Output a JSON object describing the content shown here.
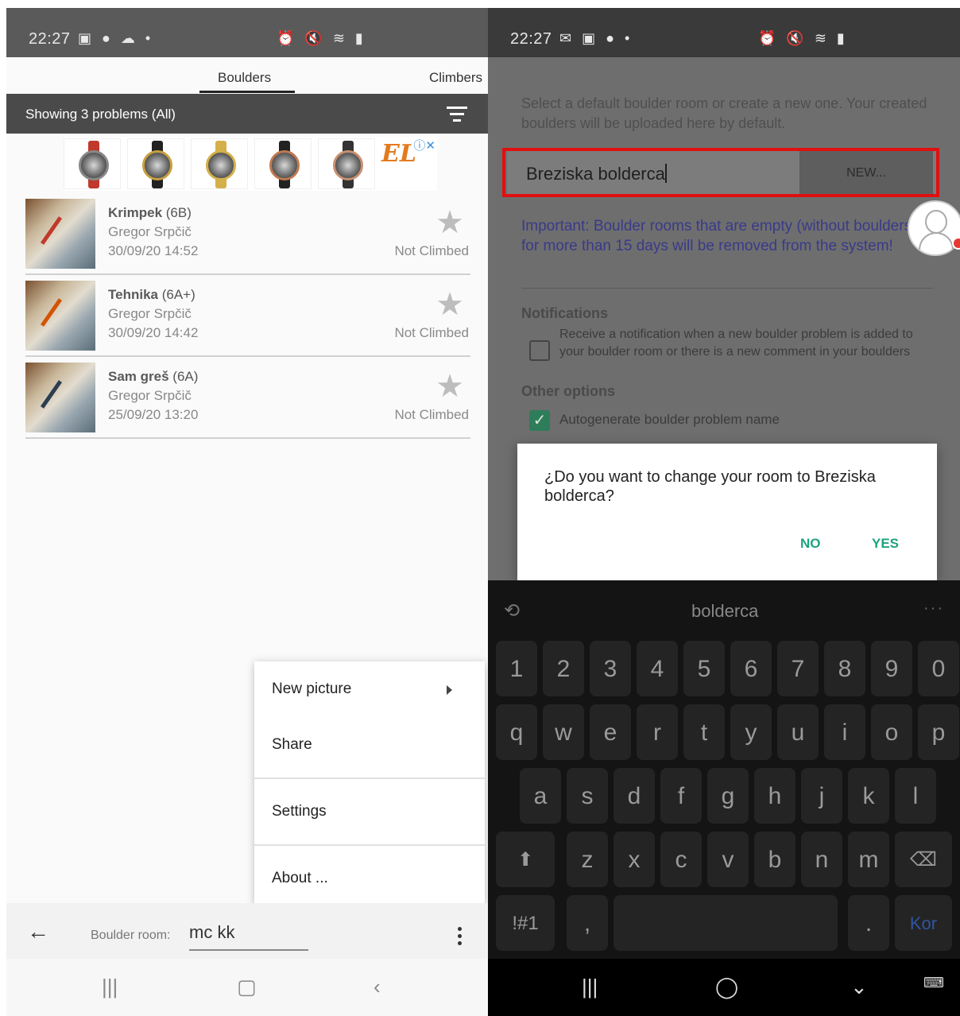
{
  "left": {
    "status_time": "22:27",
    "status_icons_left": "▣ ● ☁ •",
    "status_icons_right": "⏰ 🔇 ≋ ▮",
    "tabs": [
      "Boulders",
      "Climbers"
    ],
    "filter_text": "Showing 3 problems (All)",
    "ad_close": "ⓘ✕",
    "ad_logo": "EL",
    "problems": [
      {
        "name": "Krimpek",
        "grade": "(6B)",
        "author": "Gregor Srpčič",
        "date": "30/09/20 14:52",
        "status": "Not Climbed"
      },
      {
        "name": "Tehnika",
        "grade": "(6A+)",
        "author": "Gregor Srpčič",
        "date": "30/09/20 14:42",
        "status": "Not Climbed"
      },
      {
        "name": "Sam greš",
        "grade": "(6A)",
        "author": "Gregor Srpčič",
        "date": "25/09/20 13:20",
        "status": "Not Climbed"
      }
    ],
    "menu": [
      "New picture",
      "Share",
      "Settings",
      "About ..."
    ],
    "boulder_room_label": "Boulder room:",
    "boulder_room_value": "mc kk"
  },
  "right": {
    "status_time": "22:27",
    "status_icons_left": "✉ ▣ ● •",
    "status_icons_right": "⏰ 🔇 ≋ ▮",
    "intro_text": "Select a default boulder room or create a new one. Your created boulders will be uploaded here by default.",
    "room_input_value": "Breziska bolderca",
    "new_button": "NEW...",
    "important_text": "Important: Boulder rooms that are empty (without boulders) for more than 15 days will be removed from the system!",
    "notifications_heading": "Notifications",
    "notification_text": "Receive a notification when a new boulder problem is added to your boulder room or there is a new comment in your boulders",
    "other_options_heading": "Other options",
    "autogenerate_text": "Autogenerate boulder problem name",
    "dialog_message": "¿Do you want to change your room to Breziska bolderca?",
    "dialog_no": "NO",
    "dialog_yes": "YES",
    "keyboard_suggestion": "bolderca",
    "keyboard_rows": {
      "numbers": [
        "1",
        "2",
        "3",
        "4",
        "5",
        "6",
        "7",
        "8",
        "9",
        "0"
      ],
      "row1": [
        "q",
        "w",
        "e",
        "r",
        "t",
        "y",
        "u",
        "i",
        "o",
        "p"
      ],
      "row2": [
        "a",
        "s",
        "d",
        "f",
        "g",
        "h",
        "j",
        "k",
        "l"
      ],
      "row3": [
        "z",
        "x",
        "c",
        "v",
        "b",
        "n",
        "m"
      ],
      "bottom": [
        "!#1",
        ",",
        ".",
        "Kor"
      ]
    }
  }
}
